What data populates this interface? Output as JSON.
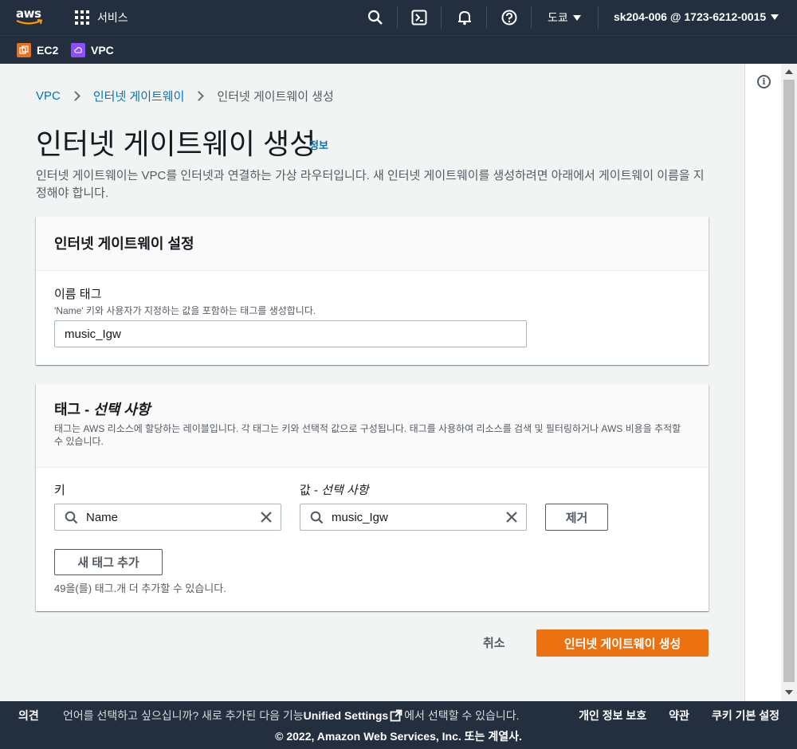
{
  "topnav": {
    "logo_text": "aws",
    "services_label": "서비스",
    "region": "도쿄",
    "account": "sk204-006 @ 1723-6212-0015"
  },
  "favorites": [
    {
      "label": "EC2",
      "color": "#e7711b"
    },
    {
      "label": "VPC",
      "color": "#8c4fff"
    }
  ],
  "breadcrumb": {
    "items": [
      "VPC",
      "인터넷 게이트웨이"
    ],
    "current": "인터넷 게이트웨이 생성"
  },
  "page": {
    "title": "인터넷 게이트웨이 생성",
    "info_link": "정보",
    "description": "인터넷 게이트웨이는 VPC를 인터넷과 연결하는 가상 라우터입니다. 새 인터넷 게이트웨이를 생성하려면 아래에서 게이트웨이 이름을 지정해야 합니다."
  },
  "settings_panel": {
    "title": "인터넷 게이트웨이 설정",
    "name_tag_label": "이름 태그",
    "name_tag_hint": "'Name' 키와 사용자가 지정하는 값을 포함하는 태그를 생성합니다.",
    "name_tag_value": "music_Igw"
  },
  "tags_panel": {
    "title_prefix": "태그 - ",
    "title_optional": "선택 사항",
    "description": "태그는 AWS 리소스에 할당하는 레이블입니다. 각 태그는 키와 선택적 값으로 구성됩니다. 태그를 사용하여 리소스를 검색 및 필터링하거나 AWS 비용을 추적할 수 있습니다.",
    "key_label": "키",
    "value_label_prefix": "값 - ",
    "value_label_optional": "선택 사항",
    "key_value": "Name",
    "value_value": "music_Igw",
    "remove_button": "제거",
    "add_tag_button": "새 태그 추가",
    "remaining_hint": "49을(를) 태그.개 더 추가할 수 있습니다."
  },
  "actions": {
    "cancel": "취소",
    "create": "인터넷 게이트웨이 생성",
    "primary_color": "#ec7211"
  },
  "footer": {
    "feedback": "의견",
    "lang_prefix": "언어를 선택하고 싶으십니까? 새로 추가된 다음 기능",
    "lang_link": "Unified Settings",
    "lang_suffix": "에서 선택할 수 있습니다.",
    "privacy": "개인 정보 보호",
    "terms": "약관",
    "cookies": "쿠키 기본 설정",
    "copyright": "© 2022, Amazon Web Services, Inc. 또는 계열사."
  }
}
